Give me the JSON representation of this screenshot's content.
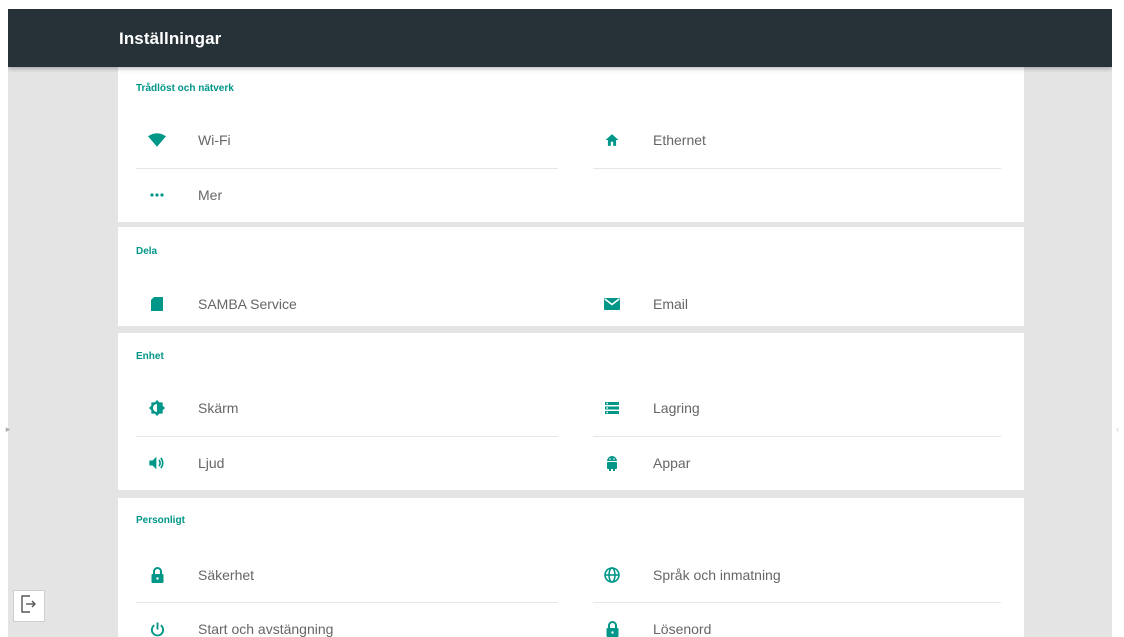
{
  "toolbar": {
    "title": "Inställningar"
  },
  "sections": [
    {
      "title": "Trådlöst och nätverk",
      "items": [
        {
          "label": "Wi-Fi",
          "icon": "wifi-icon"
        },
        {
          "label": "Ethernet",
          "icon": "home-icon"
        },
        {
          "label": "Mer",
          "icon": "more-dots-icon"
        }
      ]
    },
    {
      "title": "Dela",
      "items": [
        {
          "label": "SAMBA Service",
          "icon": "sd-card-icon"
        },
        {
          "label": "Email",
          "icon": "email-icon"
        }
      ]
    },
    {
      "title": "Enhet",
      "items": [
        {
          "label": "Skärm",
          "icon": "brightness-icon"
        },
        {
          "label": "Lagring",
          "icon": "storage-icon"
        },
        {
          "label": "Ljud",
          "icon": "volume-icon"
        },
        {
          "label": "Appar",
          "icon": "android-icon"
        }
      ]
    },
    {
      "title": "Personligt",
      "items": [
        {
          "label": "Säkerhet",
          "icon": "lock-icon"
        },
        {
          "label": "Språk och inmatning",
          "icon": "globe-icon"
        },
        {
          "label": "Start och avstängning",
          "icon": "power-icon"
        },
        {
          "label": "Lösenord",
          "icon": "lock-icon"
        }
      ]
    }
  ],
  "colors": {
    "toolbar": "#263238",
    "accent": "#009688",
    "background": "#e4e4e4",
    "card": "#ffffff",
    "label": "#666666"
  }
}
